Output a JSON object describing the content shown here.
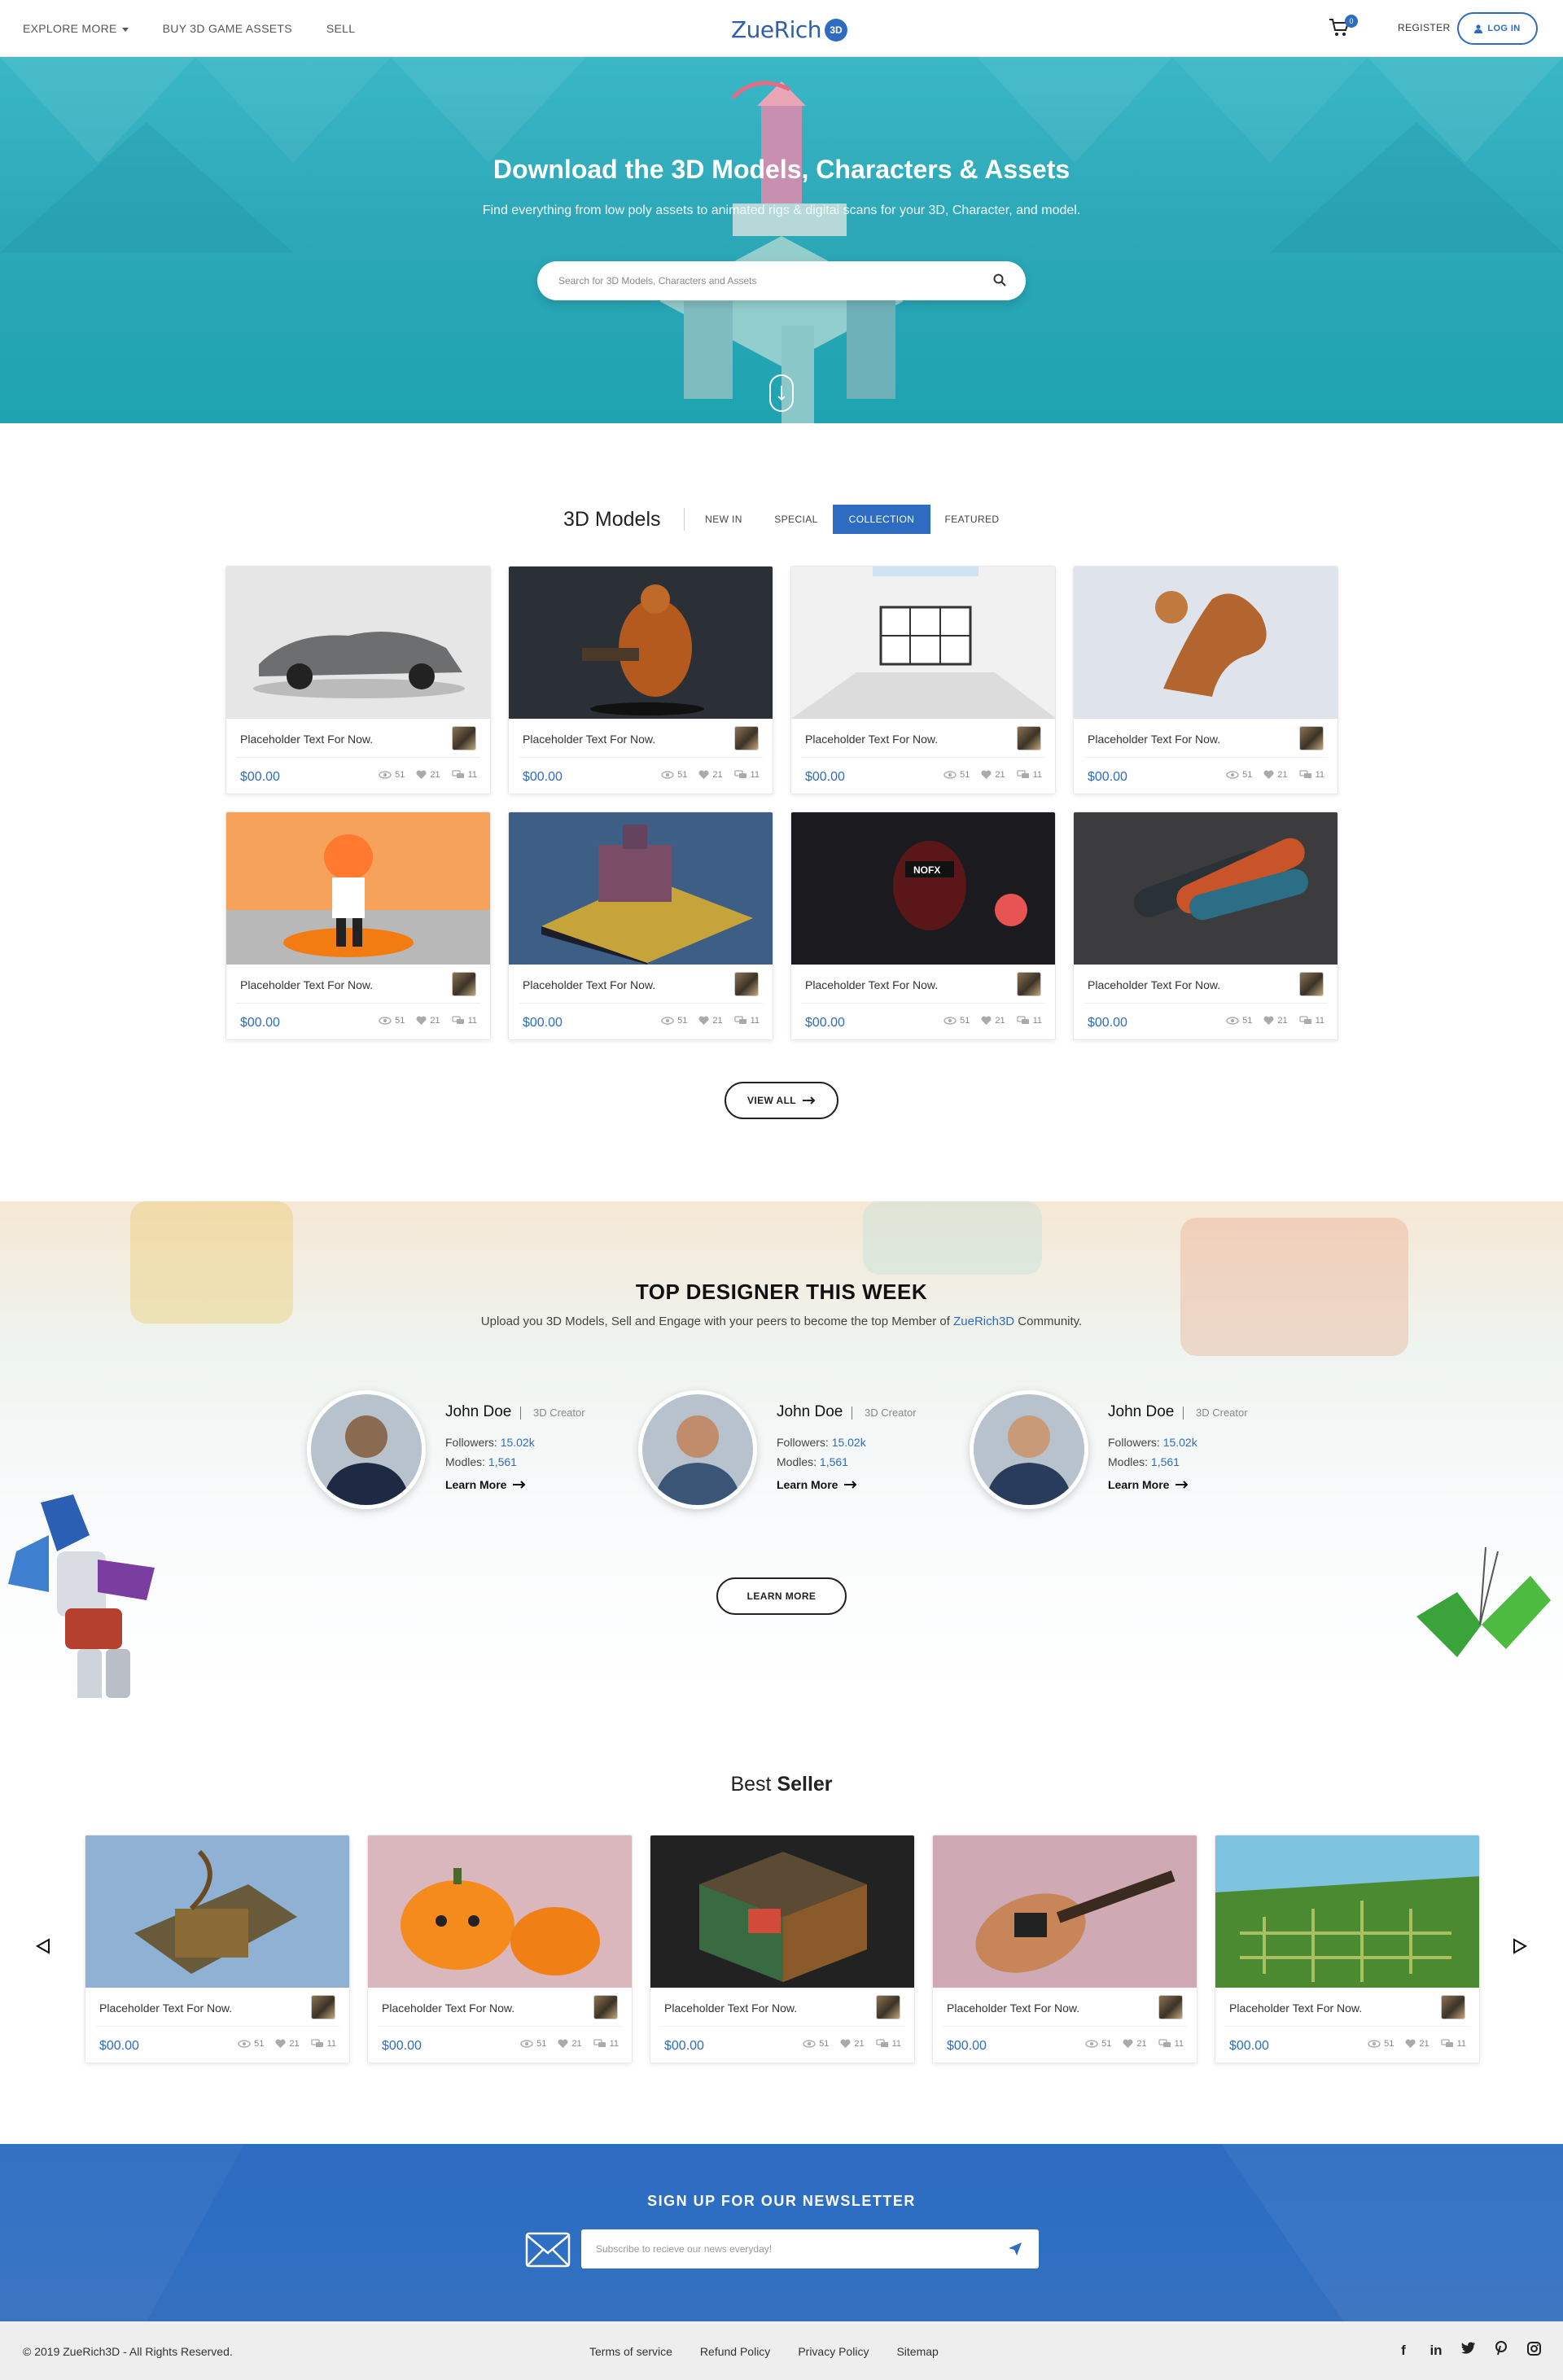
{
  "header": {
    "nav": [
      "EXPLORE MORE",
      "BUY 3D GAME ASSETS",
      "SELL"
    ],
    "logo_word": "ZueRich",
    "logo_badge": "3D",
    "cart_count": "0",
    "register": "REGISTER",
    "login": "LOG IN"
  },
  "hero": {
    "title": "Download the 3D Models, Characters & Assets",
    "subtitle": "Find everything from low poly assets to animated rigs & digital scans for your 3D, Character, and model.",
    "search_placeholder": "Search for 3D Models, Characters and Assets"
  },
  "models": {
    "title": "3D Models",
    "tabs": [
      "NEW IN",
      "SPECIAL",
      "COLLECTION",
      "FEATURED"
    ],
    "active_tab": "COLLECTION",
    "cards": [
      {
        "title": "Placeholder Text For Now.",
        "price": "$00.00",
        "views": "51",
        "likes": "21",
        "comments": "11",
        "thumb": "car"
      },
      {
        "title": "Placeholder Text For Now.",
        "price": "$00.00",
        "views": "51",
        "likes": "21",
        "comments": "11",
        "thumb": "monster"
      },
      {
        "title": "Placeholder Text For Now.",
        "price": "$00.00",
        "views": "51",
        "likes": "21",
        "comments": "11",
        "thumb": "room"
      },
      {
        "title": "Placeholder Text For Now.",
        "price": "$00.00",
        "views": "51",
        "likes": "21",
        "comments": "11",
        "thumb": "gecko"
      },
      {
        "title": "Placeholder Text For Now.",
        "price": "$00.00",
        "views": "51",
        "likes": "21",
        "comments": "11",
        "thumb": "inkling"
      },
      {
        "title": "Placeholder Text For Now.",
        "price": "$00.00",
        "views": "51",
        "likes": "21",
        "comments": "11",
        "thumb": "island"
      },
      {
        "title": "Placeholder Text For Now.",
        "price": "$00.00",
        "views": "51",
        "likes": "21",
        "comments": "11",
        "thumb": "helmet"
      },
      {
        "title": "Placeholder Text For Now.",
        "price": "$00.00",
        "views": "51",
        "likes": "21",
        "comments": "11",
        "thumb": "skateboards"
      }
    ],
    "view_all": "VIEW ALL"
  },
  "designers": {
    "title": "TOP DESIGNER THIS WEEK",
    "subtitle_pre": "Upload you 3D Models, Sell and Engage with your peers to become the top Member of ",
    "subtitle_brand": "ZueRich3D",
    "subtitle_post": " Community.",
    "items": [
      {
        "name": "John Doe",
        "role": "3D Creator",
        "followers_label": "Followers:",
        "followers": "15.02k",
        "models_label": "Modles:",
        "models": "1,561",
        "learn": "Learn More"
      },
      {
        "name": "John Doe",
        "role": "3D Creator",
        "followers_label": "Followers:",
        "followers": "15.02k",
        "models_label": "Modles:",
        "models": "1,561",
        "learn": "Learn More"
      },
      {
        "name": "John Doe",
        "role": "3D Creator",
        "followers_label": "Followers:",
        "followers": "15.02k",
        "models_label": "Modles:",
        "models": "1,561",
        "learn": "Learn More"
      }
    ],
    "learn_more_button": "LEARN MORE"
  },
  "best_seller": {
    "title_a": "Best",
    "title_b": "Seller",
    "cards": [
      {
        "title": "Placeholder Text For Now.",
        "price": "$00.00",
        "views": "51",
        "likes": "21",
        "comments": "11",
        "thumb": "chest"
      },
      {
        "title": "Placeholder Text For Now.",
        "price": "$00.00",
        "views": "51",
        "likes": "21",
        "comments": "11",
        "thumb": "pumpkins"
      },
      {
        "title": "Placeholder Text For Now.",
        "price": "$00.00",
        "views": "51",
        "likes": "21",
        "comments": "11",
        "thumb": "voxel-room"
      },
      {
        "title": "Placeholder Text For Now.",
        "price": "$00.00",
        "views": "51",
        "likes": "21",
        "comments": "11",
        "thumb": "guitar"
      },
      {
        "title": "Placeholder Text For Now.",
        "price": "$00.00",
        "views": "51",
        "likes": "21",
        "comments": "11",
        "thumb": "maze"
      }
    ]
  },
  "newsletter": {
    "title": "SIGN UP FOR OUR NEWSLETTER",
    "placeholder": "Subscribe to recieve our news everyday!"
  },
  "footer": {
    "copyright": "© 2019 ZueRich3D - All Rights Reserved.",
    "links": [
      "Terms of service",
      "Refund Policy",
      "Privacy Policy",
      "Sitemap"
    ],
    "social": [
      "facebook-icon",
      "linkedin-icon",
      "twitter-icon",
      "pinterest-icon",
      "instagram-icon"
    ]
  },
  "colors": {
    "accent": "#2d6cc0",
    "hero": "#2da8b8",
    "newsletter": "#2d6cc0",
    "footer": "#eeeeee"
  }
}
